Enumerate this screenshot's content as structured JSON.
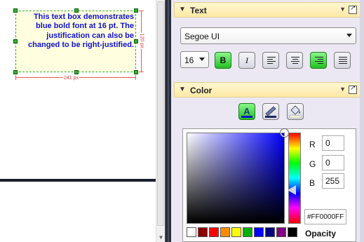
{
  "canvas": {
    "text_box": {
      "text": "This text box demonstrates blue bold font at 16 pt. The justification can also be changed to be right-justified.",
      "text_color": "#1010d0",
      "fill_color": "#ffffe0"
    },
    "width_label": "241 px",
    "height_label": "120 px"
  },
  "text_section": {
    "title": "Text",
    "font_family": "Segoe UI",
    "font_size": "16",
    "bold_label": "B",
    "italic_label": "I",
    "bold_active": true,
    "alignment": "right"
  },
  "color_section": {
    "title": "Color",
    "mode_buttons": [
      "text-color-icon",
      "line-color-icon",
      "fill-color-icon"
    ],
    "active_mode": "text-color-icon",
    "r_label": "R",
    "g_label": "G",
    "b_label": "B",
    "r": "0",
    "g": "0",
    "b": "255",
    "hex": "#FF0000FF",
    "opacity_label": "Opacity",
    "swatches": [
      "#ffffff",
      "#8b0000",
      "#ff0000",
      "#ff8c00",
      "#ffff00",
      "#00b000",
      "#0000ff",
      "#000080",
      "#800080",
      "#000000"
    ]
  }
}
